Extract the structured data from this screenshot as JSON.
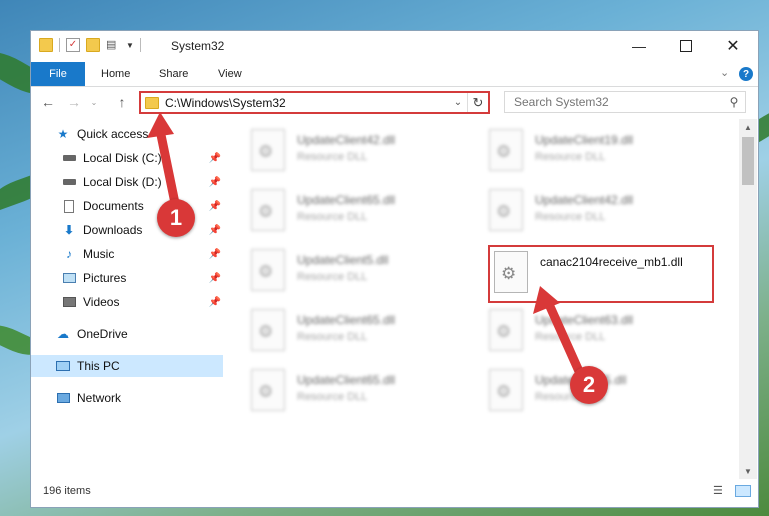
{
  "window": {
    "title": "System32"
  },
  "ribbon": {
    "tabs": [
      "File",
      "Home",
      "Share",
      "View"
    ]
  },
  "address": {
    "path": "C:\\Windows\\System32"
  },
  "search": {
    "placeholder": "Search System32"
  },
  "sidebar": {
    "items": [
      {
        "label": "Quick access",
        "icon": "star-icon",
        "pinned": false
      },
      {
        "label": "Local Disk (C:)",
        "icon": "drive-icon",
        "pinned": true
      },
      {
        "label": "Local Disk (D:)",
        "icon": "drive-icon",
        "pinned": true
      },
      {
        "label": "Documents",
        "icon": "documents-icon",
        "pinned": true
      },
      {
        "label": "Downloads",
        "icon": "download-icon",
        "pinned": true
      },
      {
        "label": "Music",
        "icon": "music-icon",
        "pinned": true
      },
      {
        "label": "Pictures",
        "icon": "pictures-icon",
        "pinned": true
      },
      {
        "label": "Videos",
        "icon": "videos-icon",
        "pinned": true
      },
      {
        "label": "OneDrive",
        "icon": "cloud-icon",
        "pinned": false
      },
      {
        "label": "This PC",
        "icon": "computer-icon",
        "pinned": false,
        "selected": true
      },
      {
        "label": "Network",
        "icon": "network-icon",
        "pinned": false
      }
    ]
  },
  "files": [
    {
      "name": "UpdateClient42.dll",
      "type": "Resource DLL"
    },
    {
      "name": "UpdateClient19.dll",
      "type": "Resource DLL"
    },
    {
      "name": "UpdateClient65.dll",
      "type": "Resource DLL"
    },
    {
      "name": "UpdateClient42.dll",
      "type": "Resource DLL"
    },
    {
      "name": "UpdateClient5.dll",
      "type": "Resource DLL"
    },
    {
      "name": "canac2104receive_mb1.dll",
      "type": "",
      "highlighted": true
    },
    {
      "name": "UpdateClient65.dll",
      "type": "Resource DLL"
    },
    {
      "name": "UpdateClient63.dll",
      "type": "Resource DLL"
    },
    {
      "name": "UpdateClient65.dll",
      "type": "Resource DLL"
    },
    {
      "name": "UpdateClient5.dll",
      "type": "Resource DLL"
    }
  ],
  "status": {
    "item_count": "196 items"
  },
  "callouts": [
    {
      "number": "1"
    },
    {
      "number": "2"
    }
  ],
  "colors": {
    "accent": "#1979ca",
    "highlight_border": "#d43b3b",
    "callout": "#d93838",
    "selected_bg": "#cce8ff"
  }
}
